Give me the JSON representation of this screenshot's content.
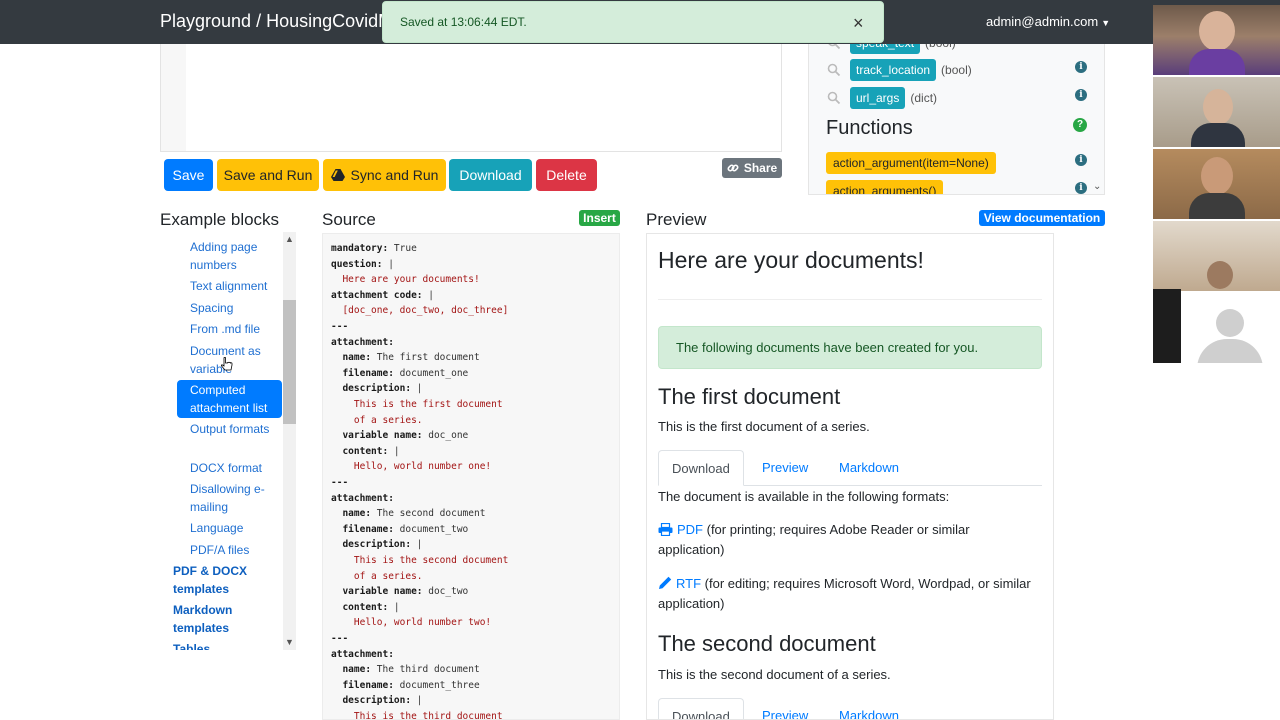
{
  "navbar": {
    "title": "Playground / HousingCovidM",
    "user": "admin@admin.com"
  },
  "toast": {
    "message": "Saved at 13:06:44 EDT.",
    "close_symbol": "×"
  },
  "toolbar": {
    "save": "Save",
    "save_and_run": "Save and Run",
    "sync_and_run": "Sync and Run",
    "download": "Download",
    "delete": "Delete",
    "share": "Share"
  },
  "variables": [
    {
      "name": "speak_text",
      "type": "(bool)"
    },
    {
      "name": "track_location",
      "type": "(bool)"
    },
    {
      "name": "url_args",
      "type": "(dict)"
    }
  ],
  "functions": {
    "heading": "Functions",
    "items": [
      "action_argument(item=None)",
      "action_arguments()"
    ]
  },
  "columns": {
    "example_blocks": "Example blocks",
    "source": "Source",
    "insert": "Insert",
    "preview": "Preview",
    "view_documentation": "View documentation"
  },
  "example_blocks": {
    "items": [
      "Adding page numbers",
      "Text alignment",
      "Spacing",
      "From .md file",
      "Document as variable",
      "Computed attachment list",
      "Output formats",
      "DOCX format",
      "Disallowing e-mailing",
      "Language",
      "PDF/A files"
    ],
    "active": "Computed attachment list",
    "sections": [
      "PDF & DOCX templates",
      "Markdown templates",
      "Tables"
    ]
  },
  "source": {
    "lines": [
      {
        "key": "mandatory:",
        "val": " True"
      },
      {
        "key": "question:",
        "val": " |"
      },
      {
        "key": "",
        "val": "  Here are your documents!"
      },
      {
        "key": "attachment code:",
        "val": " |"
      },
      {
        "key": "",
        "val": "  [doc_one, doc_two, doc_three]"
      },
      {
        "key": "---",
        "val": ""
      },
      {
        "key": "attachment:",
        "val": ""
      },
      {
        "key": "  name:",
        "val": " The first document"
      },
      {
        "key": "  filename:",
        "val": " document_one"
      },
      {
        "key": "  description:",
        "val": " |"
      },
      {
        "key": "",
        "val": "    This is the first document"
      },
      {
        "key": "",
        "val": "    of a series."
      },
      {
        "key": "  variable name:",
        "val": " doc_one"
      },
      {
        "key": "  content:",
        "val": " |"
      },
      {
        "key": "",
        "val": "    Hello, world number one!"
      },
      {
        "key": "---",
        "val": ""
      },
      {
        "key": "attachment:",
        "val": ""
      },
      {
        "key": "  name:",
        "val": " The second document"
      },
      {
        "key": "  filename:",
        "val": " document_two"
      },
      {
        "key": "  description:",
        "val": " |"
      },
      {
        "key": "",
        "val": "    This is the second document"
      },
      {
        "key": "",
        "val": "    of a series."
      },
      {
        "key": "  variable name:",
        "val": " doc_two"
      },
      {
        "key": "  content:",
        "val": " |"
      },
      {
        "key": "",
        "val": "    Hello, world number two!"
      },
      {
        "key": "---",
        "val": ""
      },
      {
        "key": "attachment:",
        "val": ""
      },
      {
        "key": "  name:",
        "val": " The third document"
      },
      {
        "key": "  filename:",
        "val": " document_three"
      },
      {
        "key": "  description:",
        "val": " |"
      },
      {
        "key": "",
        "val": "    This is the third document"
      }
    ]
  },
  "preview": {
    "title": "Here are your documents!",
    "alert": "The following documents have been created for you.",
    "doc1_title": "The first document",
    "doc1_desc": "This is the first document of a series.",
    "doc2_title": "The second document",
    "doc2_desc": "This is the second document of a series.",
    "tabs": [
      "Download",
      "Preview",
      "Markdown"
    ],
    "formats_intro": "The document is available in the following formats:",
    "pdf_link": "PDF",
    "pdf_desc": " (for printing; requires Adobe Reader or similar application)",
    "rtf_link": "RTF",
    "rtf_desc": " (for editing; requires Microsoft Word, Wordpad, or similar application)"
  },
  "colors": {
    "navbar": "#343a40",
    "primary": "#007bff",
    "warning": "#ffc107",
    "info": "#17a2b8",
    "danger": "#dc3545",
    "success_bg": "#d4edda"
  }
}
